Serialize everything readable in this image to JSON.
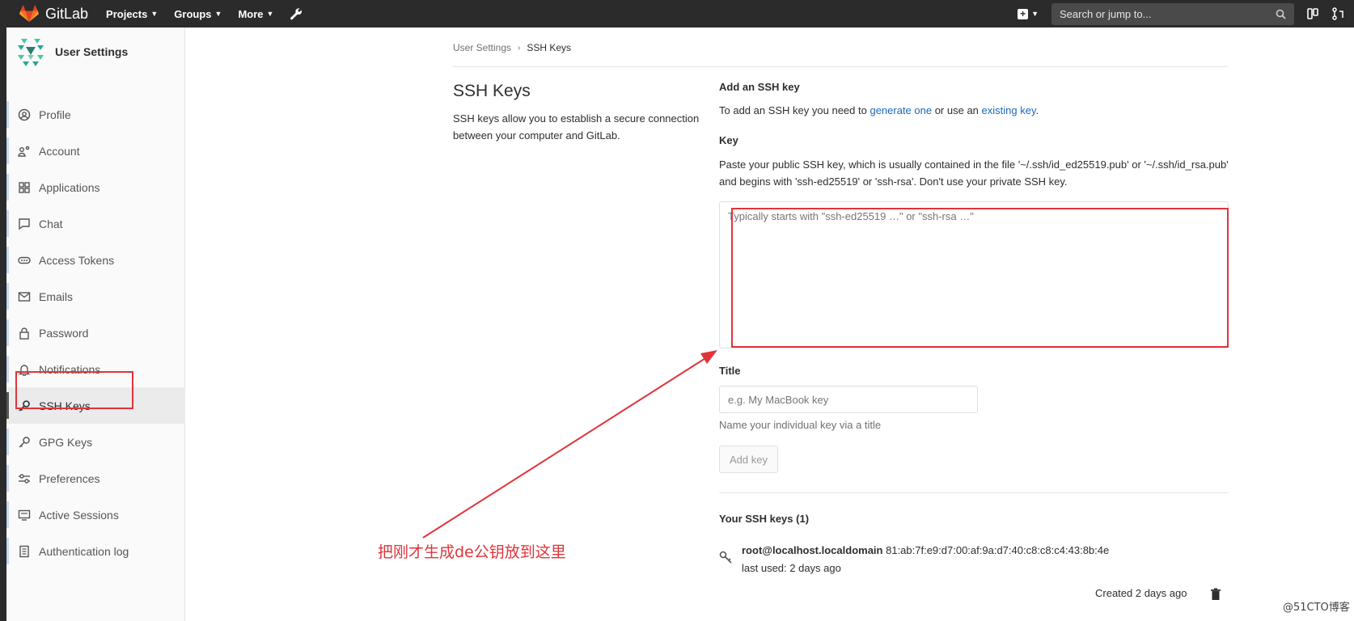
{
  "navbar": {
    "brand": "GitLab",
    "menu": [
      {
        "label": "Projects"
      },
      {
        "label": "Groups"
      },
      {
        "label": "More"
      }
    ],
    "search_placeholder": "Search or jump to..."
  },
  "sidebar": {
    "title": "User Settings",
    "items": [
      {
        "label": "Profile",
        "icon": "profile-icon"
      },
      {
        "label": "Account",
        "icon": "account-icon"
      },
      {
        "label": "Applications",
        "icon": "applications-icon"
      },
      {
        "label": "Chat",
        "icon": "chat-icon"
      },
      {
        "label": "Access Tokens",
        "icon": "access-tokens-icon"
      },
      {
        "label": "Emails",
        "icon": "emails-icon"
      },
      {
        "label": "Password",
        "icon": "lock-icon"
      },
      {
        "label": "Notifications",
        "icon": "bell-icon"
      },
      {
        "label": "SSH Keys",
        "icon": "key-icon"
      },
      {
        "label": "GPG Keys",
        "icon": "key-icon"
      },
      {
        "label": "Preferences",
        "icon": "preferences-icon"
      },
      {
        "label": "Active Sessions",
        "icon": "monitor-icon"
      },
      {
        "label": "Authentication log",
        "icon": "log-icon"
      }
    ],
    "active_index": 8
  },
  "breadcrumb": {
    "parent": "User Settings",
    "current": "SSH Keys"
  },
  "page": {
    "title": "SSH Keys",
    "description": "SSH keys allow you to establish a secure connection between your computer and GitLab."
  },
  "form": {
    "add_title": "Add an SSH key",
    "add_text_prefix": "To add an SSH key you need to ",
    "generate_link": "generate one",
    "add_text_middle": " or use an ",
    "existing_link": "existing key",
    "add_text_suffix": ".",
    "key_label": "Key",
    "key_help": "Paste your public SSH key, which is usually contained in the file '~/.ssh/id_ed25519.pub' or '~/.ssh/id_rsa.pub' and begins with 'ssh-ed25519' or 'ssh-rsa'. Don't use your private SSH key.",
    "key_placeholder": "Typically starts with \"ssh-ed25519 …\" or \"ssh-rsa …\"",
    "title_label": "Title",
    "title_placeholder": "e.g. My MacBook key",
    "title_help": "Name your individual key via a title",
    "add_button": "Add key"
  },
  "keys_list": {
    "heading": "Your SSH keys (1)",
    "keys": [
      {
        "name": "root@localhost.localdomain",
        "fingerprint": "81:ab:7f:e9:d7:00:af:9a:d7:40:c8:c8:c4:43:8b:4e",
        "last_used": "last used: 2 days ago",
        "created": "Created 2 days ago"
      }
    ]
  },
  "annotation": {
    "text": "把刚才生成de公钥放到这里",
    "color": "#e0343a"
  },
  "watermark": "@51CTO博客"
}
